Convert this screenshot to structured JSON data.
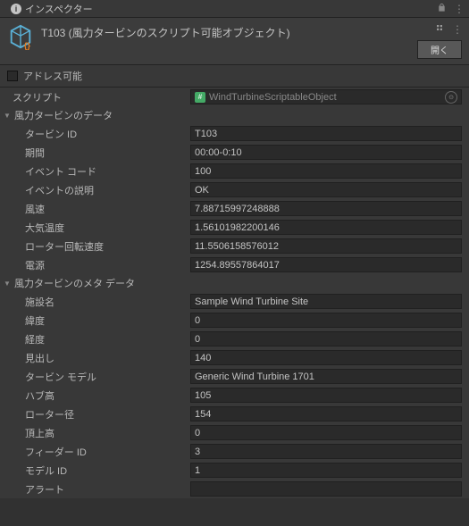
{
  "tab": {
    "title": "インスペクター"
  },
  "header": {
    "asset_name": "T103 (風力タービンのスクリプト可能オブジェクト)",
    "open_label": "開く"
  },
  "addressable": {
    "label": "アドレス可能"
  },
  "script": {
    "label": "スクリプト",
    "value": "WindTurbineScriptableObject"
  },
  "section_data": {
    "title": "風力タービンのデータ",
    "fields": {
      "turbine_id": {
        "label": "タービン ID",
        "value": "T103"
      },
      "period": {
        "label": "期間",
        "value": "00:00-0:10"
      },
      "event_code": {
        "label": "イベント コード",
        "value": "100"
      },
      "event_desc": {
        "label": "イベントの説明",
        "value": "OK"
      },
      "wind_speed": {
        "label": "風速",
        "value": "7.88715997248888"
      },
      "ambient_temp": {
        "label": "大気温度",
        "value": "1.56101982200146"
      },
      "rotor_speed": {
        "label": "ローター回転速度",
        "value": "11.5506158576012"
      },
      "power": {
        "label": "電源",
        "value": "1254.89557864017"
      }
    }
  },
  "section_meta": {
    "title": "風力タービンのメタ データ",
    "fields": {
      "site_name": {
        "label": "施設名",
        "value": "Sample Wind Turbine Site"
      },
      "latitude": {
        "label": "緯度",
        "value": "0"
      },
      "longitude": {
        "label": "経度",
        "value": "0"
      },
      "heading": {
        "label": "見出し",
        "value": "140"
      },
      "turbine_model": {
        "label": "タービン モデル",
        "value": "Generic Wind Turbine 1701"
      },
      "hub_height": {
        "label": "ハブ高",
        "value": "105"
      },
      "rotor_diam": {
        "label": "ローター径",
        "value": "154"
      },
      "tip_height": {
        "label": "頂上高",
        "value": "0"
      },
      "feeder_id": {
        "label": "フィーダー ID",
        "value": "3"
      },
      "model_id": {
        "label": "モデル ID",
        "value": "1"
      },
      "alert": {
        "label": "アラート",
        "value": ""
      }
    }
  }
}
